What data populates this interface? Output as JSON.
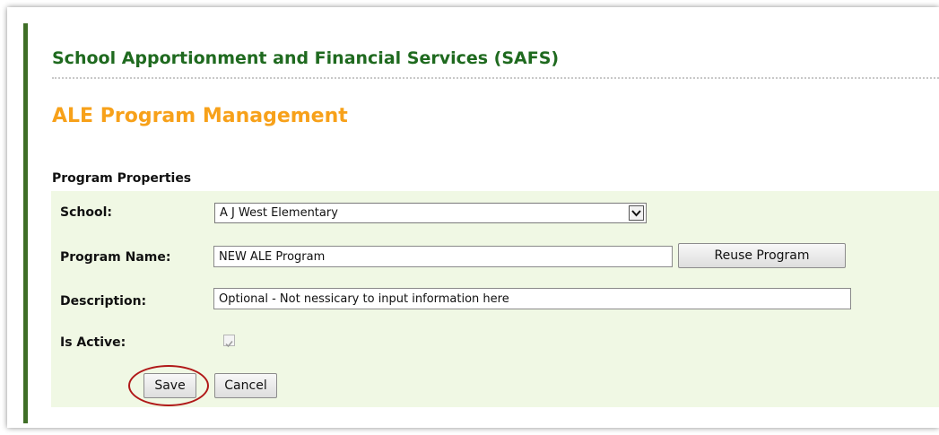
{
  "header": {
    "site_title": "School Apportionment and Financial Services (SAFS)",
    "page_title": "ALE Program Management"
  },
  "form": {
    "section_heading": "Program Properties",
    "school": {
      "label": "School:",
      "selected_value": "A J West Elementary",
      "arrow_icon": "chevron-down-icon"
    },
    "program_name": {
      "label": "Program Name:",
      "value": "NEW ALE Program",
      "reuse_label": "Reuse Program"
    },
    "description": {
      "label": "Description:",
      "value": "Optional - Not nessicary to input information here"
    },
    "is_active": {
      "label": "Is Active:",
      "checked": true
    },
    "actions": {
      "save_label": "Save",
      "cancel_label": "Cancel"
    }
  },
  "colors": {
    "site_title": "#1f6a1f",
    "page_title": "#f7a11a",
    "accent_bar": "#3f6e26",
    "panel_background": "#f0f8e4",
    "highlight_ring": "#b01818"
  }
}
